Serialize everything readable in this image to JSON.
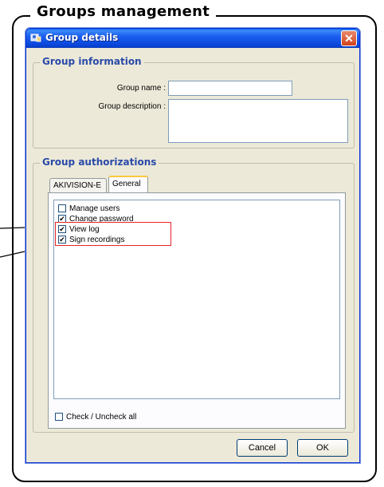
{
  "frame": {
    "title": "Groups management"
  },
  "window": {
    "title": "Group details",
    "close_glyph": "✕",
    "icons": {
      "title_icon": "group-window-icon",
      "close_icon": "close-icon"
    }
  },
  "group_information": {
    "legend": "Group information",
    "name_label": "Group name :",
    "name_value": "",
    "description_label": "Group description :",
    "description_value": ""
  },
  "group_authorizations": {
    "legend": "Group authorizations",
    "tabs": [
      {
        "label": "AKIVISION-E",
        "active": false
      },
      {
        "label": "General",
        "active": true
      }
    ],
    "items": [
      {
        "label": "Manage users",
        "checked": false
      },
      {
        "label": "Change password",
        "checked": true
      },
      {
        "label": "View log",
        "checked": true
      },
      {
        "label": "Sign recordings",
        "checked": true
      }
    ],
    "check_all": {
      "label": "Check / Uncheck all",
      "checked": false
    }
  },
  "buttons": {
    "cancel": "Cancel",
    "ok": "OK"
  },
  "colors": {
    "titlebar": "#0845d8",
    "legend_text": "#2a4aa8",
    "highlight": "#e8232b",
    "window_bg": "#ece9d8"
  }
}
